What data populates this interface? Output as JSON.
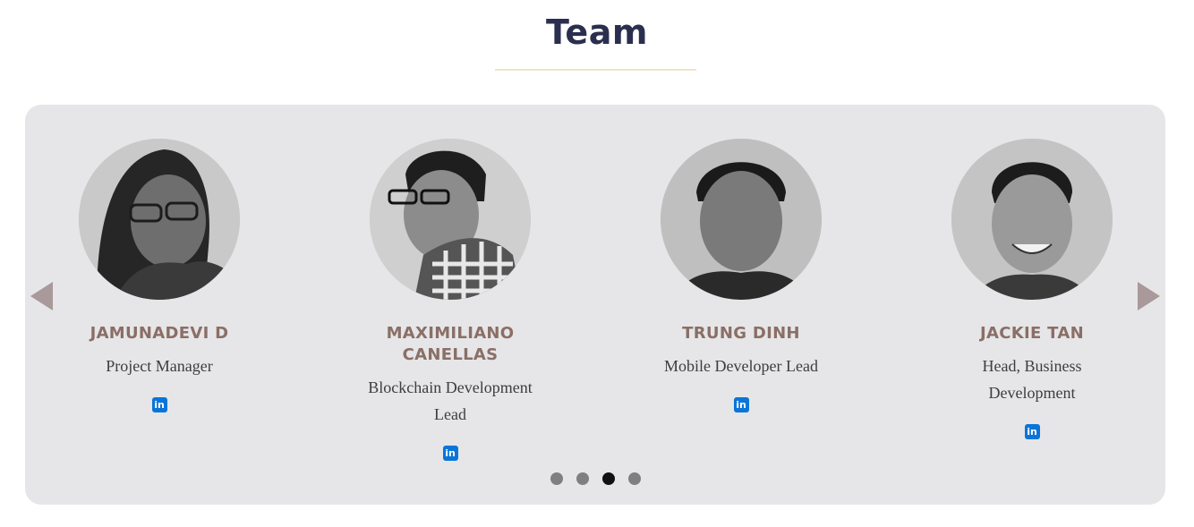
{
  "section": {
    "title": "Team"
  },
  "carousel": {
    "prev_icon": "triangle-left",
    "next_icon": "triangle-right",
    "active_dot": 2,
    "dot_count": 4
  },
  "members": [
    {
      "name": "JAMUNADEVI D",
      "role": "Project Manager",
      "social_icon": "linkedin-icon",
      "social_label": "in"
    },
    {
      "name": "MAXIMILIANO CANELLAS",
      "role": "Blockchain Development Lead",
      "social_icon": "linkedin-icon",
      "social_label": "in"
    },
    {
      "name": "TRUNG DINH",
      "role": "Mobile Developer Lead",
      "social_icon": "linkedin-icon",
      "social_label": "in"
    },
    {
      "name": "JACKIE TAN",
      "role": "Head, Business Development",
      "social_icon": "linkedin-icon",
      "social_label": "in"
    }
  ],
  "colors": {
    "title": "#2b2f4f",
    "name": "#8a6f66",
    "linkedin": "#0a75d8",
    "arrow": "#a9999a",
    "panel": "#e6e6e8"
  }
}
